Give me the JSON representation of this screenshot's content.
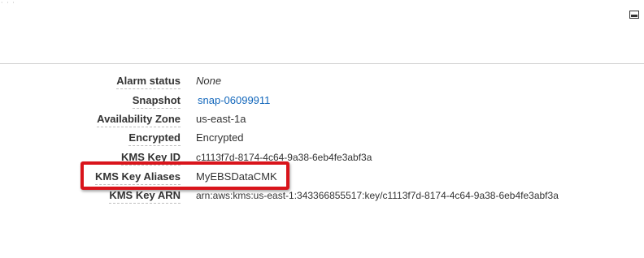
{
  "panel": {
    "minimize_icon": "minimize-icon",
    "details": [
      {
        "label": "Alarm status",
        "value": "None"
      },
      {
        "label": "Snapshot",
        "value": "snap-06099911"
      },
      {
        "label": "Availability Zone",
        "value": "us-east-1a"
      },
      {
        "label": "Encrypted",
        "value": "Encrypted"
      },
      {
        "label": "KMS Key ID",
        "value": "c1113f7d-8174-4c64-9a38-6eb4fe3abf3a"
      },
      {
        "label": "KMS Key Aliases",
        "value": "MyEBSDataCMK"
      },
      {
        "label": "KMS Key ARN",
        "value": "arn:aws:kms:us-east-1:343366855517:key/c1113f7d-8174-4c64-9a38-6eb4fe3abf3a"
      }
    ]
  },
  "colors": {
    "link": "#1166bb",
    "highlight": "#d9141b",
    "divider": "#cfcfcf"
  }
}
